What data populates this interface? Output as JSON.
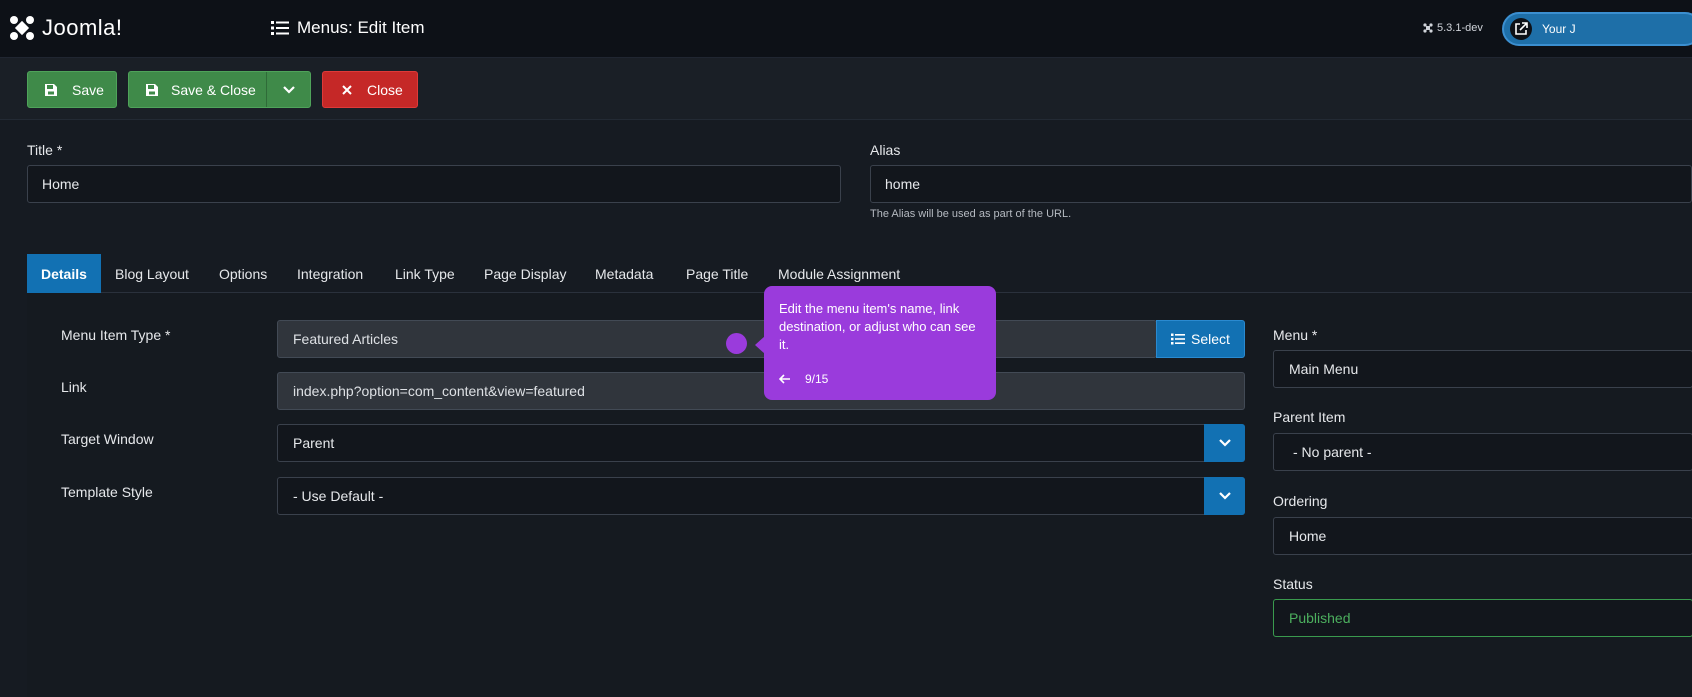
{
  "header": {
    "logo_text": "Joomla!",
    "page_title": "Menus: Edit Item",
    "version": "5.3.1-dev",
    "site_button_label": "Your J"
  },
  "toolbar": {
    "save_label": "Save",
    "save_close_label": "Save & Close",
    "close_label": "Close"
  },
  "form": {
    "title_label": "Title *",
    "title_value": "Home",
    "alias_label": "Alias",
    "alias_value": "home",
    "alias_hint": "The Alias will be used as part of the URL."
  },
  "tabs": [
    {
      "label": "Details",
      "active": true
    },
    {
      "label": "Blog Layout"
    },
    {
      "label": "Options"
    },
    {
      "label": "Integration"
    },
    {
      "label": "Link Type"
    },
    {
      "label": "Page Display"
    },
    {
      "label": "Metadata"
    },
    {
      "label": "Page Title"
    },
    {
      "label": "Module Assignment"
    }
  ],
  "details": {
    "menu_item_type_label": "Menu Item Type *",
    "menu_item_type_value": "Featured Articles",
    "select_button_label": "Select",
    "link_label": "Link",
    "link_value": "index.php?option=com_content&view=featured",
    "target_window_label": "Target Window",
    "target_window_value": "Parent",
    "template_style_label": "Template Style",
    "template_style_value": "- Use Default -"
  },
  "sidebar": {
    "menu_label": "Menu *",
    "menu_value": "Main Menu",
    "parent_label": "Parent Item",
    "parent_value": "- No parent -",
    "ordering_label": "Ordering",
    "ordering_value": "Home",
    "status_label": "Status",
    "status_value": "Published"
  },
  "tooltip": {
    "text": "Edit the menu item's name, link destination, or adjust who can see it.",
    "progress": "9/15"
  },
  "colors": {
    "primary": "#1271b3",
    "success": "#3f8a49",
    "danger": "#c52827",
    "tour": "#9a3bdc"
  }
}
